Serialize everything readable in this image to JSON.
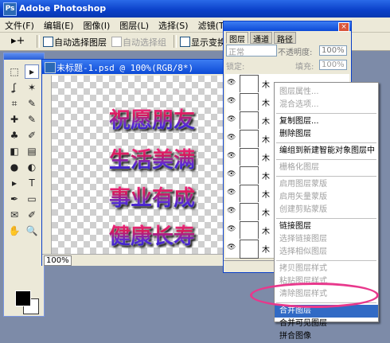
{
  "app": {
    "title": "Adobe Photoshop",
    "logo_text": "Ps"
  },
  "menu": [
    "文件(F)",
    "编辑(E)",
    "图像(I)",
    "图层(L)",
    "选择(S)",
    "滤镜(T)",
    "视图(V)"
  ],
  "options": {
    "tool_glyph": "▸+",
    "auto_select_layer": "自动选择图层",
    "auto_select_group": "自动选择组",
    "show_transform": "显示变换控件"
  },
  "document": {
    "title": "未标题-1.psd @ 100%(RGB/8*)",
    "zoom": "100%",
    "lines": [
      "祝愿朋友",
      "生活美满",
      "事业有成",
      "健康长寿"
    ]
  },
  "layers_panel": {
    "tabs": [
      "图层",
      "通道",
      "路径"
    ],
    "blend_mode": "正常",
    "opacity_label": "不透明度:",
    "opacity_value": "100%",
    "lock_label": "锁定:",
    "fill_label": "填充:",
    "fill_value": "100%",
    "close_glyph": "×",
    "eye_glyph": "👁",
    "layer_name_glyph": "木"
  },
  "context_menu": {
    "items": [
      {
        "label": "图层属性...",
        "enabled": false
      },
      {
        "label": "混合选项...",
        "enabled": false
      },
      {
        "label": "复制图层...",
        "enabled": true
      },
      {
        "label": "删除图层",
        "enabled": true
      },
      {
        "label": "编组到新建智能对象图层中",
        "enabled": true
      },
      {
        "label": "栅格化图层",
        "enabled": false
      },
      {
        "label": "启用图层蒙版",
        "enabled": false
      },
      {
        "label": "启用矢量蒙版",
        "enabled": false
      },
      {
        "label": "创建剪贴蒙版",
        "enabled": false
      },
      {
        "label": "链接图层",
        "enabled": true
      },
      {
        "label": "选择链接图层",
        "enabled": false
      },
      {
        "label": "选择相似图层",
        "enabled": false
      },
      {
        "label": "拷贝图层样式",
        "enabled": false
      },
      {
        "label": "粘贴图层样式",
        "enabled": false
      },
      {
        "label": "清除图层样式",
        "enabled": false
      },
      {
        "label": "合并图层",
        "enabled": true,
        "highlighted": true
      },
      {
        "label": "合并可见图层",
        "enabled": true
      },
      {
        "label": "拼合图像",
        "enabled": true
      }
    ]
  },
  "toolbox_icons": [
    "marquee-icon",
    "move-icon",
    "lasso-icon",
    "magic-wand-icon",
    "crop-icon",
    "slice-icon",
    "healing-icon",
    "brush-icon",
    "stamp-icon",
    "history-brush-icon",
    "eraser-icon",
    "gradient-icon",
    "blur-icon",
    "dodge-icon",
    "path-select-icon",
    "type-icon",
    "pen-icon",
    "shape-icon",
    "notes-icon",
    "eyedropper-icon",
    "hand-icon",
    "zoom-icon"
  ],
  "toolbox_glyphs": [
    "⬚",
    "▸",
    "ʆ",
    "✶",
    "⌗",
    "✎",
    "✚",
    "✎",
    "♣",
    "✐",
    "◧",
    "▤",
    "●",
    "◐",
    "▸",
    "T",
    "✒",
    "▭",
    "✉",
    "✐",
    "✋",
    "🔍"
  ]
}
